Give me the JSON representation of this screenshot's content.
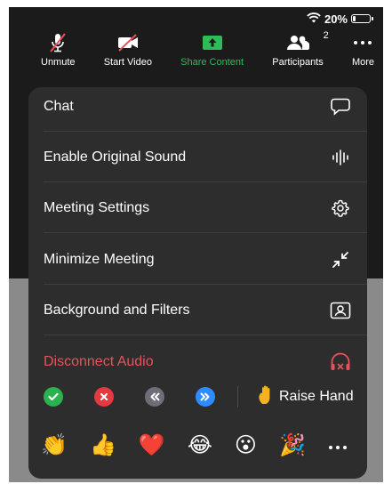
{
  "status_bar": {
    "battery_percent": "20%",
    "battery_level": 0.2
  },
  "toolbar": {
    "unmute_label": "Unmute",
    "start_video_label": "Start Video",
    "share_content_label": "Share Content",
    "participants_label": "Participants",
    "participants_count": "2",
    "more_label": "More"
  },
  "menu": {
    "items": [
      {
        "label": "Chat",
        "icon": "chat-bubble-icon"
      },
      {
        "label": "Enable Original Sound",
        "icon": "audio-wave-icon"
      },
      {
        "label": "Meeting Settings",
        "icon": "gear-icon"
      },
      {
        "label": "Minimize Meeting",
        "icon": "minimize-arrows-icon"
      },
      {
        "label": "Background and Filters",
        "icon": "portrait-frame-icon"
      },
      {
        "label": "Disconnect Audio",
        "icon": "headphones-off-icon"
      }
    ]
  },
  "reactions": {
    "raise_hand_label": "Raise Hand",
    "quick": [
      "yes-check-icon",
      "no-x-icon",
      "slower-rewind-icon",
      "faster-forward-icon"
    ],
    "emojis": [
      "👏",
      "👍",
      "❤️",
      "😂",
      "😮",
      "🎉"
    ]
  },
  "colors": {
    "share_green": "#2fbb5a",
    "danger_red": "#e6535b",
    "panel": "#2d2d2d",
    "check_green": "#2ab24e",
    "x_red": "#e5393f",
    "slower_gray": "#6e6e78",
    "faster_blue": "#2d8cff"
  }
}
